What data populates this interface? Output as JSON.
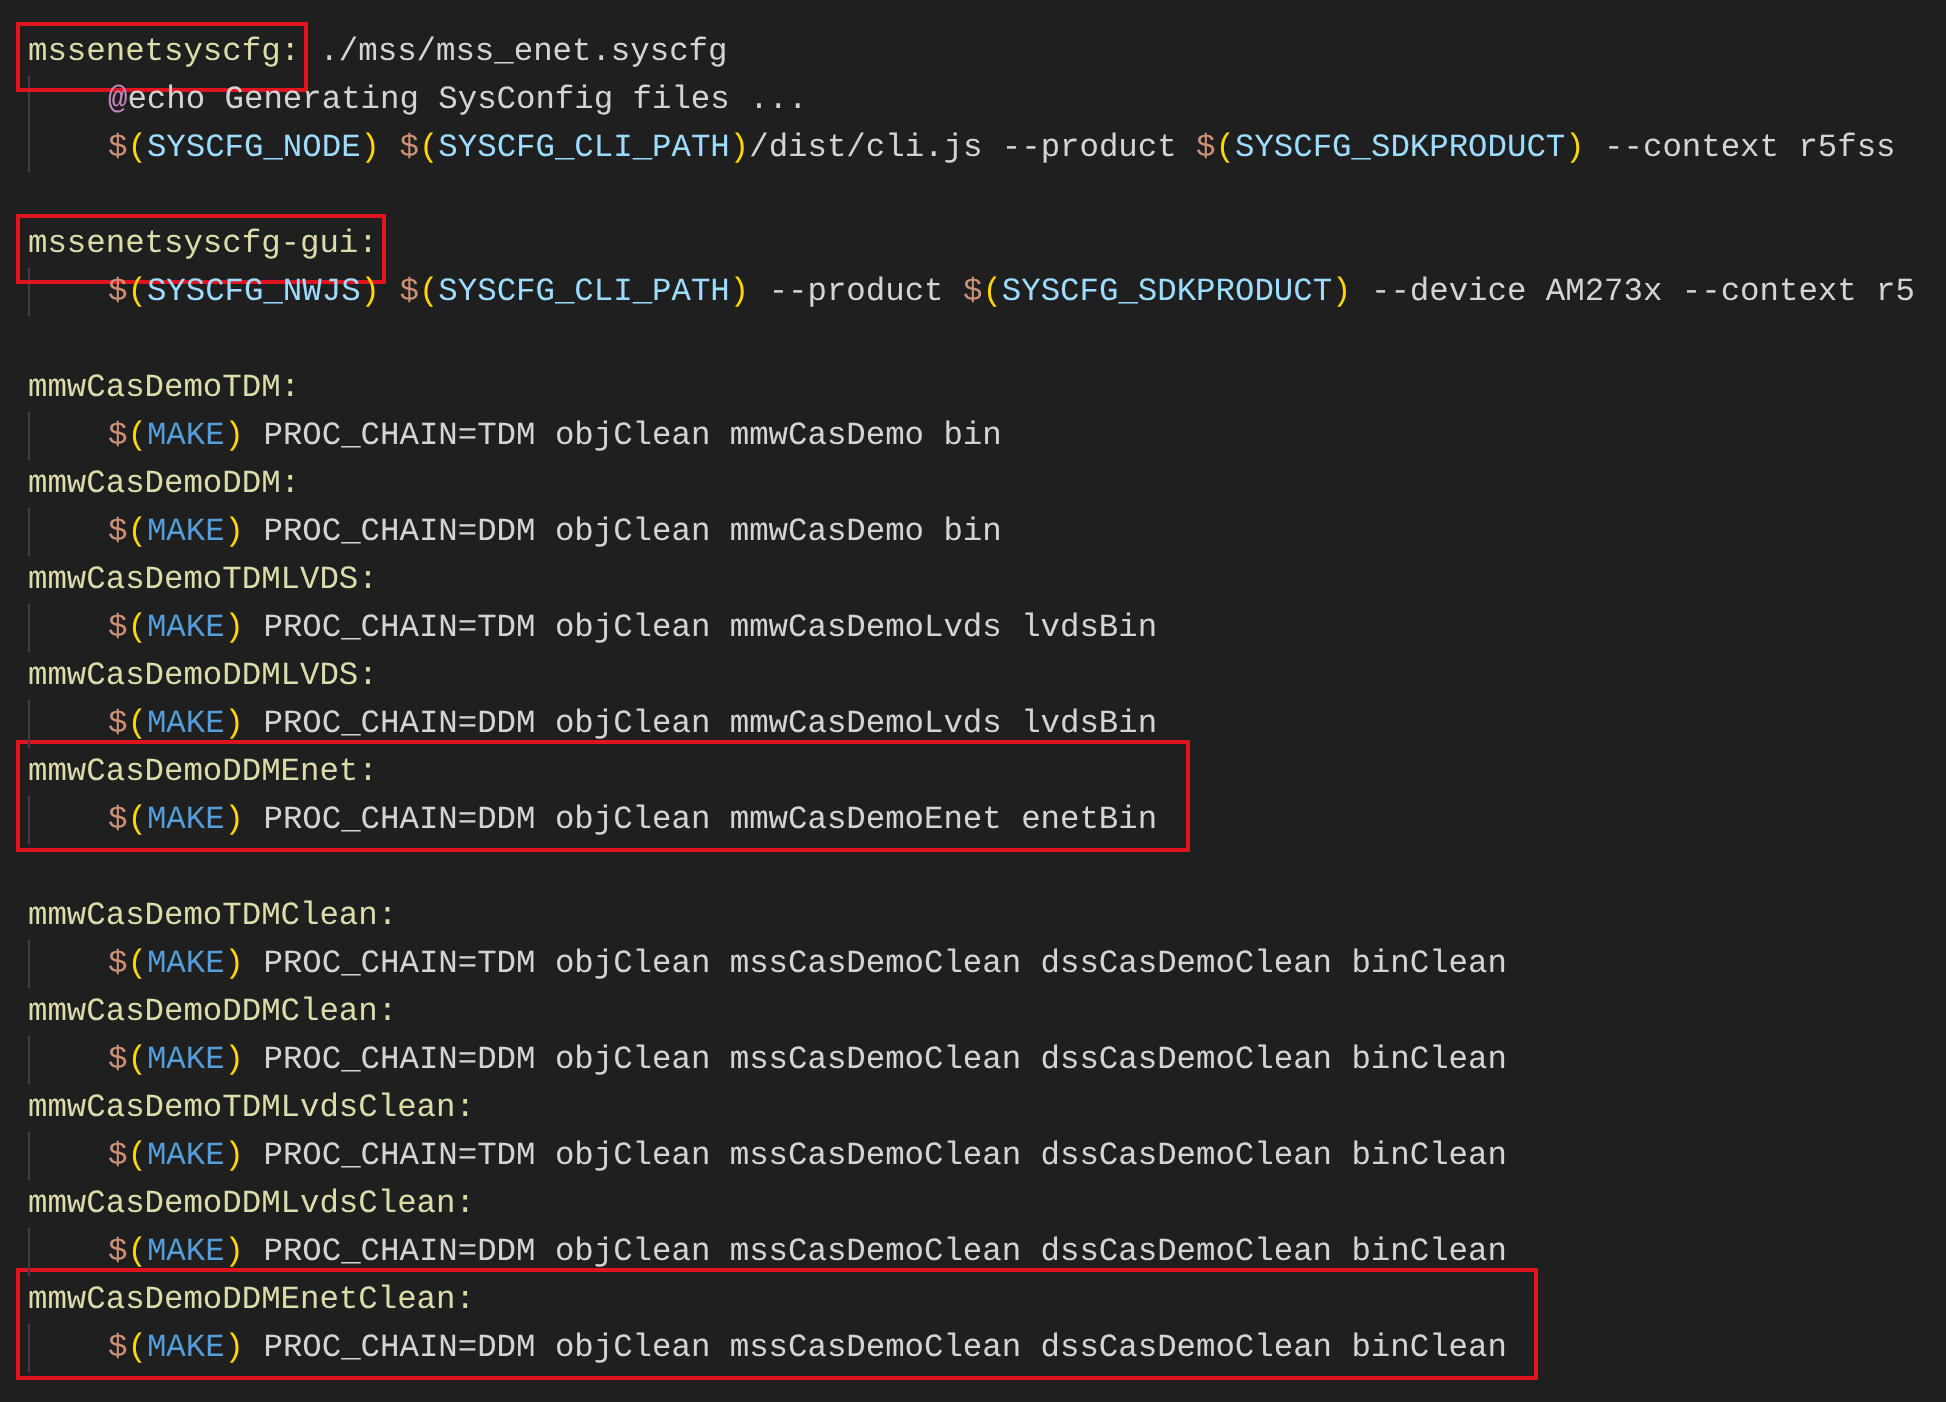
{
  "editor": {
    "blocks": [
      {
        "boxed": false,
        "lines": [
          {
            "kind": "code",
            "indented": false,
            "tokens": [
              {
                "kind": "target",
                "t": "mssenetsyscfg:",
                "boxed": true
              },
              {
                "kind": "text",
                "t": " ./mss/mss_enet.syscfg"
              }
            ]
          },
          {
            "kind": "code",
            "indented": true,
            "tokens": [
              {
                "kind": "at",
                "t": "@"
              },
              {
                "kind": "text",
                "t": "echo Generating SysConfig files ..."
              }
            ]
          },
          {
            "kind": "code",
            "indented": true,
            "tokens": [
              {
                "kind": "dollar",
                "t": "$"
              },
              {
                "kind": "paren",
                "t": "("
              },
              {
                "kind": "var",
                "t": "SYSCFG_NODE"
              },
              {
                "kind": "paren",
                "t": ") "
              },
              {
                "kind": "dollar",
                "t": "$"
              },
              {
                "kind": "paren",
                "t": "("
              },
              {
                "kind": "var",
                "t": "SYSCFG_CLI_PATH"
              },
              {
                "kind": "paren",
                "t": ")"
              },
              {
                "kind": "text",
                "t": "/dist/cli.js --product "
              },
              {
                "kind": "dollar",
                "t": "$"
              },
              {
                "kind": "paren",
                "t": "("
              },
              {
                "kind": "var",
                "t": "SYSCFG_SDKPRODUCT"
              },
              {
                "kind": "paren",
                "t": ")"
              },
              {
                "kind": "text",
                "t": " --context r5fss"
              }
            ]
          },
          {
            "kind": "blank"
          },
          {
            "kind": "code",
            "indented": false,
            "tokens": [
              {
                "kind": "target",
                "t": "mssenetsyscfg-gui:",
                "boxed": true
              }
            ]
          },
          {
            "kind": "code",
            "indented": true,
            "tokens": [
              {
                "kind": "dollar",
                "t": "$"
              },
              {
                "kind": "paren",
                "t": "("
              },
              {
                "kind": "var",
                "t": "SYSCFG_NWJS"
              },
              {
                "kind": "paren",
                "t": ") "
              },
              {
                "kind": "dollar",
                "t": "$"
              },
              {
                "kind": "paren",
                "t": "("
              },
              {
                "kind": "var",
                "t": "SYSCFG_CLI_PATH"
              },
              {
                "kind": "paren",
                "t": ")"
              },
              {
                "kind": "text",
                "t": " --product "
              },
              {
                "kind": "dollar",
                "t": "$"
              },
              {
                "kind": "paren",
                "t": "("
              },
              {
                "kind": "var",
                "t": "SYSCFG_SDKPRODUCT"
              },
              {
                "kind": "paren",
                "t": ")"
              },
              {
                "kind": "text",
                "t": " --device AM273x --context r5"
              }
            ]
          },
          {
            "kind": "blank"
          },
          {
            "kind": "code",
            "indented": false,
            "tokens": [
              {
                "kind": "target",
                "t": "mmwCasDemoTDM:"
              }
            ]
          },
          {
            "kind": "code",
            "indented": true,
            "tokens": [
              {
                "kind": "dollar",
                "t": "$"
              },
              {
                "kind": "paren",
                "t": "("
              },
              {
                "kind": "builtin",
                "t": "MAKE"
              },
              {
                "kind": "paren",
                "t": ")"
              },
              {
                "kind": "text",
                "t": " PROC_CHAIN=TDM objClean mmwCasDemo bin"
              }
            ]
          },
          {
            "kind": "code",
            "indented": false,
            "tokens": [
              {
                "kind": "target",
                "t": "mmwCasDemoDDM:"
              }
            ]
          },
          {
            "kind": "code",
            "indented": true,
            "tokens": [
              {
                "kind": "dollar",
                "t": "$"
              },
              {
                "kind": "paren",
                "t": "("
              },
              {
                "kind": "builtin",
                "t": "MAKE"
              },
              {
                "kind": "paren",
                "t": ")"
              },
              {
                "kind": "text",
                "t": " PROC_CHAIN=DDM objClean mmwCasDemo bin"
              }
            ]
          },
          {
            "kind": "code",
            "indented": false,
            "tokens": [
              {
                "kind": "target",
                "t": "mmwCasDemoTDMLVDS:"
              }
            ]
          },
          {
            "kind": "code",
            "indented": true,
            "tokens": [
              {
                "kind": "dollar",
                "t": "$"
              },
              {
                "kind": "paren",
                "t": "("
              },
              {
                "kind": "builtin",
                "t": "MAKE"
              },
              {
                "kind": "paren",
                "t": ")"
              },
              {
                "kind": "text",
                "t": " PROC_CHAIN=TDM objClean mmwCasDemoLvds lvdsBin"
              }
            ]
          },
          {
            "kind": "code",
            "indented": false,
            "tokens": [
              {
                "kind": "target",
                "t": "mmwCasDemoDDMLVDS:"
              }
            ]
          },
          {
            "kind": "code",
            "indented": true,
            "tokens": [
              {
                "kind": "dollar",
                "t": "$"
              },
              {
                "kind": "paren",
                "t": "("
              },
              {
                "kind": "builtin",
                "t": "MAKE"
              },
              {
                "kind": "paren",
                "t": ")"
              },
              {
                "kind": "text",
                "t": " PROC_CHAIN=DDM objClean mmwCasDemoLvds lvdsBin"
              }
            ]
          }
        ]
      },
      {
        "boxed": true,
        "lines": [
          {
            "kind": "code",
            "indented": false,
            "tokens": [
              {
                "kind": "target",
                "t": "mmwCasDemoDDMEnet:"
              }
            ]
          },
          {
            "kind": "code",
            "indented": true,
            "tokens": [
              {
                "kind": "dollar",
                "t": "$"
              },
              {
                "kind": "paren",
                "t": "("
              },
              {
                "kind": "builtin",
                "t": "MAKE"
              },
              {
                "kind": "paren",
                "t": ")"
              },
              {
                "kind": "text",
                "t": " PROC_CHAIN=DDM objClean mmwCasDemoEnet enetBin"
              }
            ]
          }
        ]
      },
      {
        "boxed": false,
        "lines": [
          {
            "kind": "blank"
          },
          {
            "kind": "code",
            "indented": false,
            "tokens": [
              {
                "kind": "target",
                "t": "mmwCasDemoTDMClean:"
              }
            ]
          },
          {
            "kind": "code",
            "indented": true,
            "tokens": [
              {
                "kind": "dollar",
                "t": "$"
              },
              {
                "kind": "paren",
                "t": "("
              },
              {
                "kind": "builtin",
                "t": "MAKE"
              },
              {
                "kind": "paren",
                "t": ")"
              },
              {
                "kind": "text",
                "t": " PROC_CHAIN=TDM objClean mssCasDemoClean dssCasDemoClean binClean"
              }
            ]
          },
          {
            "kind": "code",
            "indented": false,
            "tokens": [
              {
                "kind": "target",
                "t": "mmwCasDemoDDMClean:"
              }
            ]
          },
          {
            "kind": "code",
            "indented": true,
            "tokens": [
              {
                "kind": "dollar",
                "t": "$"
              },
              {
                "kind": "paren",
                "t": "("
              },
              {
                "kind": "builtin",
                "t": "MAKE"
              },
              {
                "kind": "paren",
                "t": ")"
              },
              {
                "kind": "text",
                "t": " PROC_CHAIN=DDM objClean mssCasDemoClean dssCasDemoClean binClean"
              }
            ]
          },
          {
            "kind": "code",
            "indented": false,
            "tokens": [
              {
                "kind": "target",
                "t": "mmwCasDemoTDMLvdsClean:"
              }
            ]
          },
          {
            "kind": "code",
            "indented": true,
            "tokens": [
              {
                "kind": "dollar",
                "t": "$"
              },
              {
                "kind": "paren",
                "t": "("
              },
              {
                "kind": "builtin",
                "t": "MAKE"
              },
              {
                "kind": "paren",
                "t": ")"
              },
              {
                "kind": "text",
                "t": " PROC_CHAIN=TDM objClean mssCasDemoClean dssCasDemoClean binClean"
              }
            ]
          },
          {
            "kind": "code",
            "indented": false,
            "tokens": [
              {
                "kind": "target",
                "t": "mmwCasDemoDDMLvdsClean:"
              }
            ]
          },
          {
            "kind": "code",
            "indented": true,
            "tokens": [
              {
                "kind": "dollar",
                "t": "$"
              },
              {
                "kind": "paren",
                "t": "("
              },
              {
                "kind": "builtin",
                "t": "MAKE"
              },
              {
                "kind": "paren",
                "t": ")"
              },
              {
                "kind": "text",
                "t": " PROC_CHAIN=DDM objClean mssCasDemoClean dssCasDemoClean binClean"
              }
            ]
          }
        ]
      },
      {
        "boxed": true,
        "lines": [
          {
            "kind": "code",
            "indented": false,
            "tokens": [
              {
                "kind": "target",
                "t": "mmwCasDemoDDMEnetClean:"
              }
            ]
          },
          {
            "kind": "code",
            "indented": true,
            "tokens": [
              {
                "kind": "dollar",
                "t": "$"
              },
              {
                "kind": "paren",
                "t": "("
              },
              {
                "kind": "builtin",
                "t": "MAKE"
              },
              {
                "kind": "paren",
                "t": ")"
              },
              {
                "kind": "text",
                "t": " PROC_CHAIN=DDM objClean mssCasDemoClean dssCasDemoClean binClean"
              }
            ]
          }
        ]
      }
    ]
  }
}
